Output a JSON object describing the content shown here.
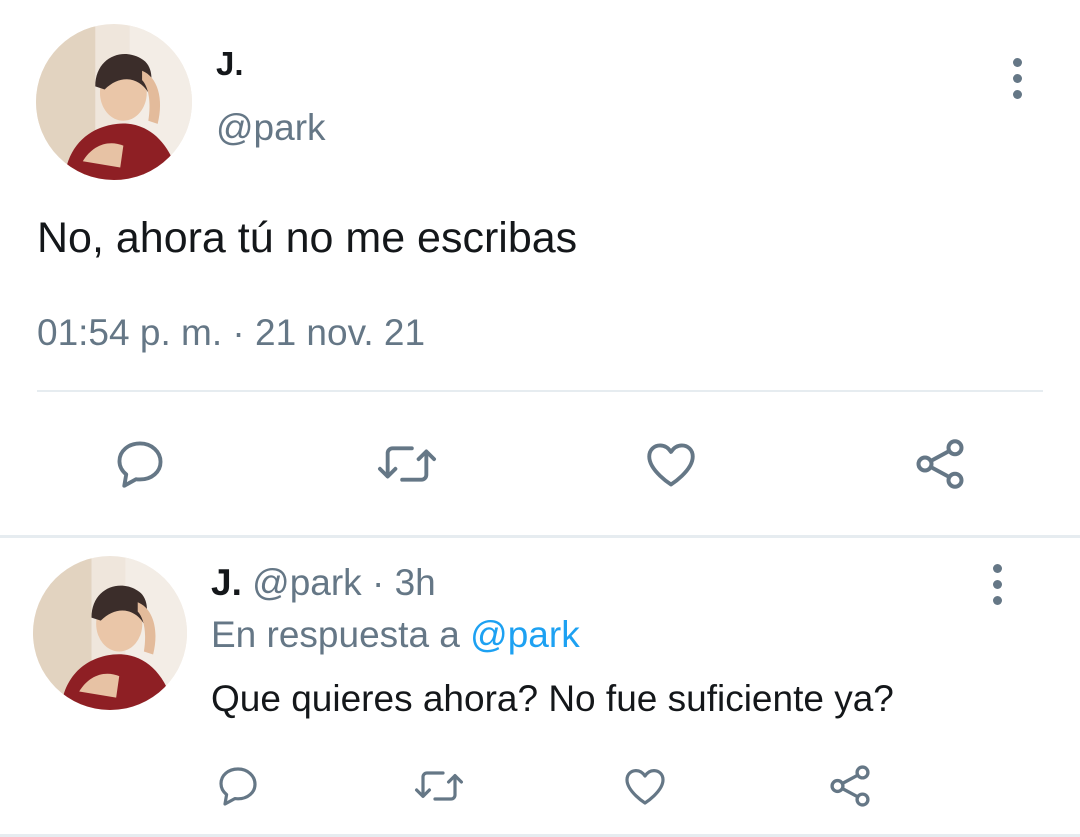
{
  "main_tweet": {
    "display_name": "J.",
    "handle": "@park",
    "text": "No, ahora tú no me escribas",
    "timestamp": "01:54 p. m. · 21 nov. 21",
    "actions": [
      "reply-icon",
      "retweet-icon",
      "like-icon",
      "share-icon"
    ]
  },
  "reply_tweet": {
    "display_name": "J.",
    "handle": "@park",
    "separator": "·",
    "time_ago": "3h",
    "replying_to_label": "En respuesta a",
    "replying_to_handle": "@park",
    "text": "Que quieres ahora? No fue suficiente ya?",
    "actions": [
      "reply-icon",
      "retweet-icon",
      "like-icon",
      "share-icon"
    ]
  },
  "colors": {
    "text_primary": "#14171a",
    "text_secondary": "#657786",
    "mention": "#1da1f2",
    "divider": "#e6ecf0"
  }
}
